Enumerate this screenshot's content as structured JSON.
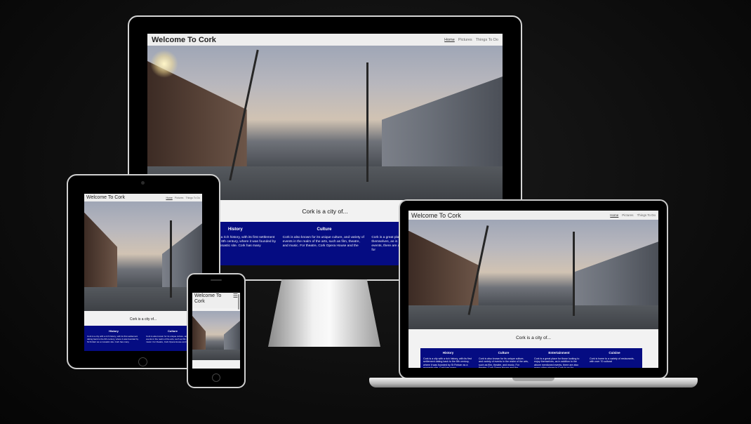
{
  "site": {
    "title": "Welcome To Cork",
    "nav": [
      "Home",
      "Pictures",
      "Things To Do"
    ],
    "tagline": "Cork is a city of...",
    "menu_icon": "hamburger-menu-icon",
    "sections": [
      {
        "heading": "History",
        "text": "Cork is a city with a rich history, with its first settlement dating back to the 6th century, where it was founded by St Finbarr as a monastic site. Cork has many"
      },
      {
        "heading": "Culture",
        "text": "Cork is also known for its unique culture, and variety of events in the realm of the arts, such as film, theatre, and music. For theatre, Cork Opera House and the"
      },
      {
        "heading": "Entertainment",
        "text": "Cork is a great place for those looking to enjoy themselves, as in addition to the above mentioned events, there are also many other places in Cork to go for"
      },
      {
        "heading": "Cuisine",
        "text": "Cork is home to a variety of restaurants, with over 70 cultural"
      }
    ]
  },
  "colors": {
    "page_background": "#0e0e0e",
    "panel": "#050c82",
    "site_background": "#f2f2f2"
  }
}
